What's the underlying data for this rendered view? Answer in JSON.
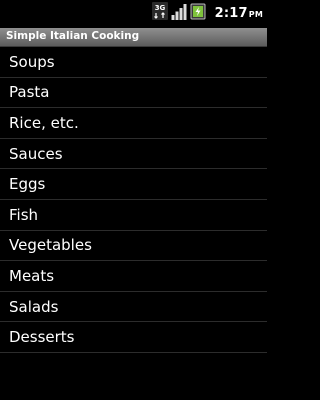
{
  "status_bar": {
    "network_label": "3G",
    "time": "2:17",
    "ampm": "PM",
    "icons": [
      "network-3g-icon",
      "signal-strength-icon",
      "battery-icon"
    ]
  },
  "app": {
    "title": "Simple Italian Cooking"
  },
  "categories": [
    {
      "label": "Soups"
    },
    {
      "label": "Pasta"
    },
    {
      "label": "Rice, etc."
    },
    {
      "label": "Sauces"
    },
    {
      "label": "Eggs"
    },
    {
      "label": "Fish"
    },
    {
      "label": "Vegetables"
    },
    {
      "label": "Meats"
    },
    {
      "label": "Salads"
    },
    {
      "label": "Desserts"
    }
  ],
  "colors": {
    "background": "#000000",
    "title_bar": "#7a7a7a",
    "battery_charge": "#7ec23c",
    "divider": "#2c2c2c"
  }
}
